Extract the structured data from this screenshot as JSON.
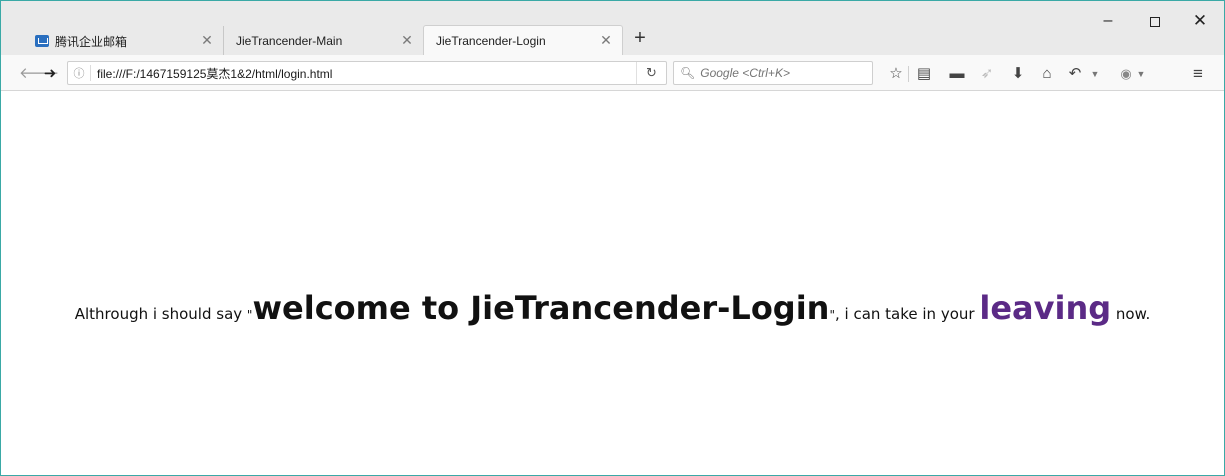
{
  "browser": {
    "tabs": [
      {
        "label": "腾讯企业邮箱",
        "active": false
      },
      {
        "label": "JieTrancender-Main",
        "active": false
      },
      {
        "label": "JieTrancender-Login",
        "active": true
      }
    ],
    "new_tab_label": "+",
    "close_glyph": "✕",
    "window_controls": {
      "minimize": "–",
      "close": "✕"
    },
    "url": "file:///F:/1467159125莫杰1&2/html/login.html",
    "search_placeholder": "Google <Ctrl+K>",
    "toolbar_icons": [
      "star-icon",
      "reader-icon",
      "folder-icon",
      "send-icon",
      "download-icon",
      "home-icon",
      "undo-icon",
      "adblock-icon",
      "menu-icon"
    ]
  },
  "page": {
    "part1": "Althrough i should say ",
    "quote_open": "\"",
    "welcome": "welcome to JieTrancender-Login",
    "quote_close": "\"",
    "part2": ", i can take in your ",
    "leaving": "leaving",
    "part3": " now.",
    "leaving_color": "#5b2a86"
  },
  "colors": {
    "window_border": "#3aa9a6",
    "tabstrip": "#eaeaea",
    "favicon": "#2a6fbf"
  }
}
